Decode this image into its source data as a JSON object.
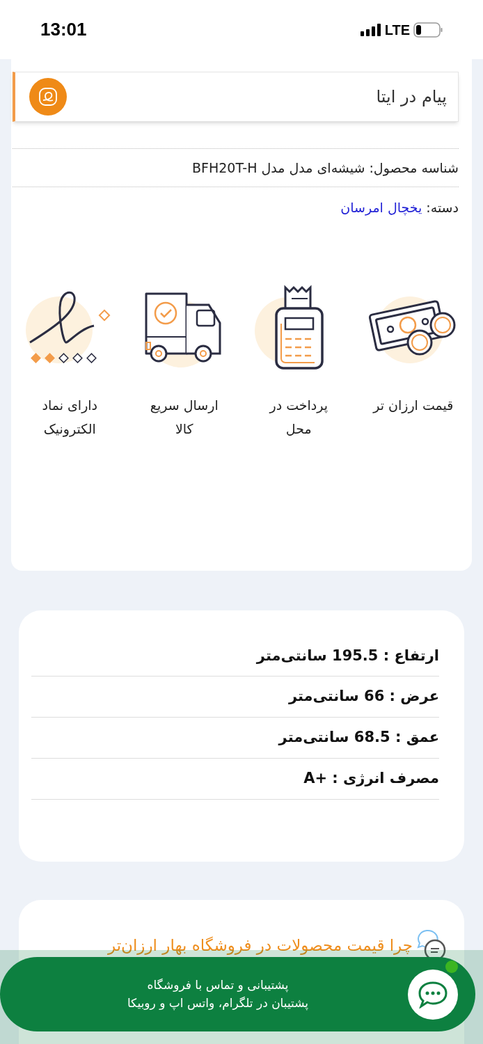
{
  "status_bar": {
    "time": "13:01",
    "network": "LTE"
  },
  "eitaa": {
    "label": "پیام در ایتا"
  },
  "product": {
    "id_text": "شناسه محصول: شیشه‌ای مدل مدل BFH20T-H",
    "category_label": "دسته:",
    "category_link": "یخچال امرسان"
  },
  "features": [
    {
      "kind": "money",
      "label": "قیمت ارزان تر"
    },
    {
      "kind": "pos",
      "label": "پرداخت در\nمحل"
    },
    {
      "kind": "truck",
      "label": "ارسال سریع\nکالا"
    },
    {
      "kind": "enamad",
      "label": "دارای نماد\nالکترونیک"
    }
  ],
  "specs": [
    {
      "text": "ارتفاع : 195.5 سانتی‌متر"
    },
    {
      "text": "عرض : 66 سانتی‌متر"
    },
    {
      "text": "عمق : 68.5 سانتی‌متر"
    },
    {
      "text": "مصرف انرژی : +A"
    }
  ],
  "why": {
    "title": "چرا قیمت محصولات در فروشگاه بهار ارزان‌تر"
  },
  "support": {
    "title": "پشتیبانی و تماس با فروشگاه",
    "subtitle": "پشتیبان در تلگرام، واتس اپ و روبیکا",
    "online": true
  }
}
